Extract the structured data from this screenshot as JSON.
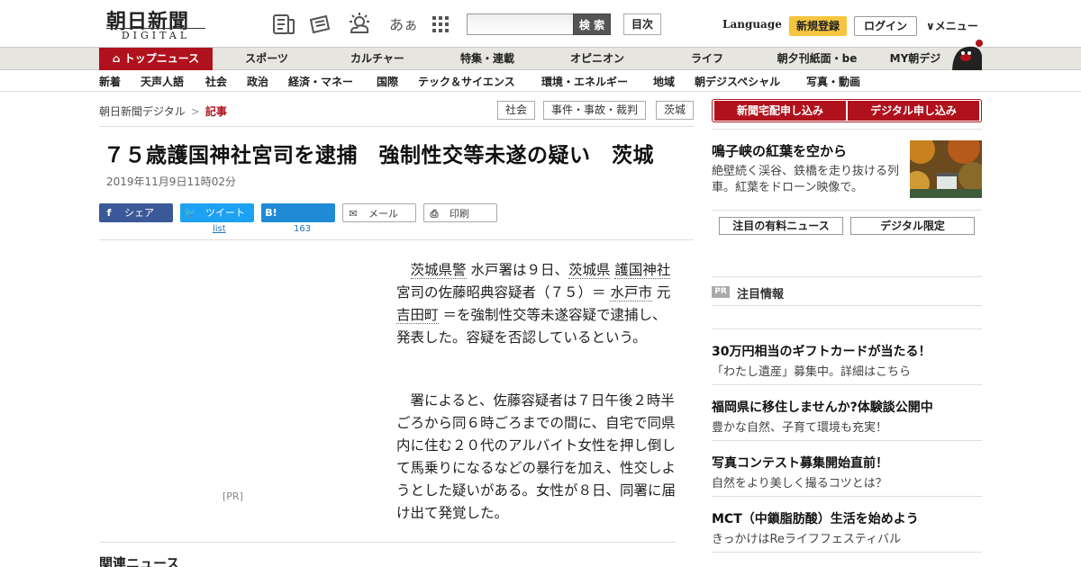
{
  "header": {
    "logo_main": "朝日新聞",
    "logo_sub": "DIGITAL",
    "font_size_icon_label": "あぁ",
    "search_button": "検 索",
    "toc_button": "目次",
    "language": "Language",
    "signup": "新規登録",
    "login": "ログイン",
    "menu": "メニュー"
  },
  "gnav": {
    "top": "トップニュース",
    "items": [
      "スポーツ",
      "カルチャー",
      "特集・連載",
      "オピニオン",
      "ライフ",
      "朝夕刊紙面・be",
      "MY朝デジ"
    ]
  },
  "subnav": {
    "items": [
      "新着",
      "天声人語",
      "社会",
      "政治",
      "経済・マネー",
      "国際",
      "テック＆サイエンス",
      "環境・エネルギー",
      "地域",
      "朝デジスペシャル",
      "写真・動画"
    ]
  },
  "breadcrumb": {
    "home": "朝日新聞デジタル",
    "sep": ">",
    "current": "記事"
  },
  "tags": [
    "社会",
    "事件・事故・裁判",
    "茨城"
  ],
  "article": {
    "title": "７５歳護国神社宮司を逮捕　強制性交等未遂の疑い　茨城",
    "date": "2019年11月9日11時02分",
    "p1": {
      "a": "茨城県警",
      "b": " 水戸署は９日、",
      "c": "茨城県",
      "d": "護国神社",
      "e": " 宮司の佐藤昭典容疑者（７５）＝ ",
      "f": "水戸市",
      "g": " 元 ",
      "h": "吉田町",
      "i": " ＝を強制性交等未遂容疑で逮捕し、発表した。容疑を否認しているという。"
    },
    "p2": "署によると、佐藤容疑者は７日午後２時半ごろから同６時ごろまでの間に、自宅で同県内に住む２０代のアルバイト女性を押し倒して馬乗りになるなどの暴行を加え、性交しようとした疑いがある。女性が８日、同署に届け出て発覚した。",
    "pr_label": "[PR]",
    "related_heading": "関連ニュース"
  },
  "share": {
    "facebook": "シェア",
    "twitter": "ツイート",
    "twitter_count": "list",
    "hatena": "ブックマーク",
    "hatena_count": "163",
    "mail": "メール",
    "print": "印刷"
  },
  "sidebar": {
    "cta_home": "新聞宅配申し込み",
    "cta_digital": "デジタル申し込み",
    "feature_title": "鳴子峡の紅葉を空から",
    "feature_desc": "絶壁続く渓谷、鉄橋を走り抜ける列車。紅葉をドローン映像で。",
    "tab_paid": "注目の有料ニュース",
    "tab_digital": "デジタル限定",
    "pr_badge": "PR",
    "pr_heading": "注目情報",
    "ads": [
      {
        "title": "30万円相当のギフトカードが当たる！",
        "sub": "「わたし遺産」募集中。詳細はこちら"
      },
      {
        "title": "福岡県に移住しませんか?体験談公開中",
        "sub": "豊かな自然、子育て環境も充実！"
      },
      {
        "title": "写真コンテスト募集開始直前！",
        "sub": "自然をより美しく撮るコツとは？"
      },
      {
        "title": "MCT（中鎖脂肪酸）生活を始めよう",
        "sub": "きっかけはReライフフェスティバル"
      }
    ]
  },
  "colors": {
    "brand_red": "#b0121d",
    "signup_yellow": "#f5c53f",
    "facebook": "#3b5998",
    "twitter": "#1da1f2"
  }
}
